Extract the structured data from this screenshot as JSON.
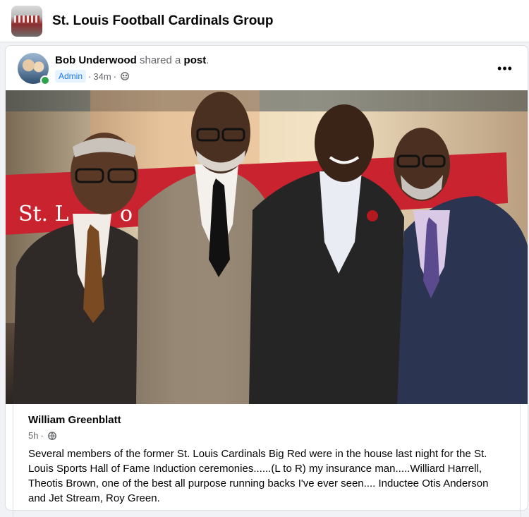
{
  "header": {
    "group_name": "St. Louis Football Cardinals Group"
  },
  "post": {
    "author": "Bob Underwood",
    "action": "shared a",
    "object": "post",
    "object_suffix": ".",
    "badge": "Admin",
    "time": "34m",
    "separator": "·",
    "privacy_icon": "group-members-icon",
    "more_icon": "more-options-icon",
    "more_label": "•••"
  },
  "shared_post": {
    "author": "William Greenblatt",
    "time": "5h",
    "separator": "·",
    "privacy_icon": "globe-icon",
    "text": "Several members of the former St. Louis Cardinals Big Red were in the house last night for the St. Louis Sports Hall of Fame Induction ceremonies......(L to R) my insurance man.....Williard Harrell, Theotis Brown, one of the best all purpose running backs I've ever seen.... Inductee Otis Anderson and Jet Stream, Roy Green."
  },
  "photo": {
    "banner_text": "St. L",
    "banner_text_2": "o"
  },
  "colors": {
    "accent": "#1877f2",
    "online": "#31a24c",
    "banner_red": "#c8232f"
  }
}
